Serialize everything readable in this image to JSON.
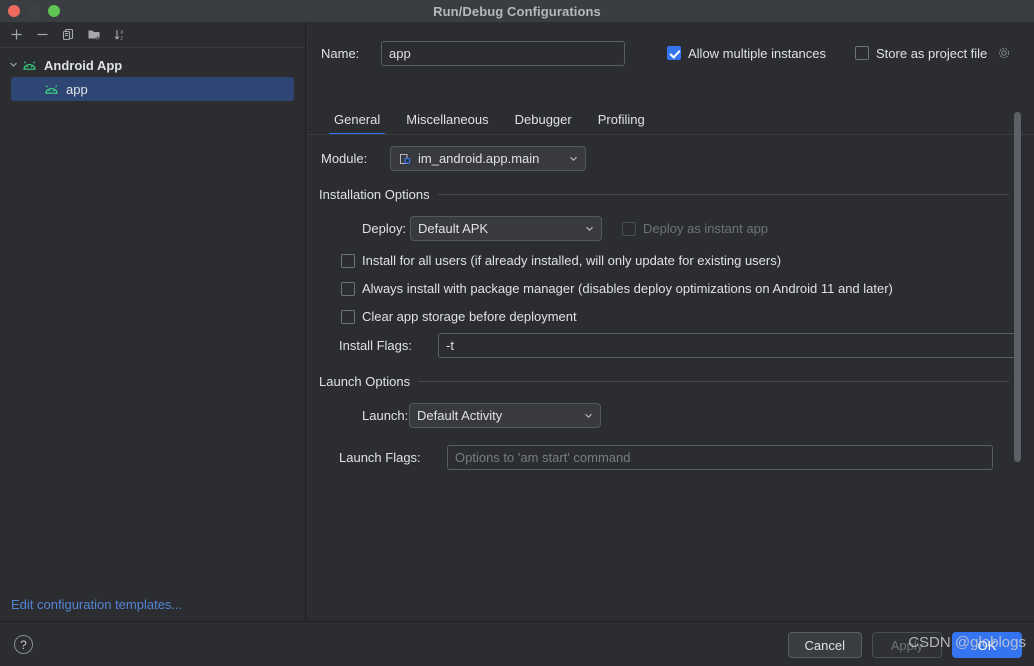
{
  "window": {
    "title": "Run/Debug Configurations",
    "traffic_lights": [
      "close-red",
      "minimize-grey",
      "maximize-green"
    ]
  },
  "sidebar": {
    "toolbar": [
      {
        "name": "add-configuration-button",
        "icon": "plus-icon"
      },
      {
        "name": "remove-configuration-button",
        "icon": "minus-icon"
      },
      {
        "name": "copy-configuration-button",
        "icon": "copy-icon"
      },
      {
        "name": "new-folder-button",
        "icon": "folder-add-icon"
      },
      {
        "name": "sort-configurations-button",
        "icon": "sort-az-icon"
      }
    ],
    "tree": [
      {
        "label": "Android App",
        "icon": "android-icon",
        "expanded": true,
        "selected": false,
        "level": 0
      },
      {
        "label": "app",
        "icon": "android-icon",
        "expanded": false,
        "selected": true,
        "level": 1
      }
    ],
    "edit_templates_link": "Edit configuration templates..."
  },
  "form": {
    "name_label": "Name:",
    "name_value": "app",
    "allow_multiple_instances": {
      "label": "Allow multiple instances",
      "checked": true
    },
    "store_as_project_file": {
      "label": "Store as project file",
      "checked": false,
      "icon": "gear-icon"
    },
    "tabs": [
      {
        "label": "General",
        "active": true
      },
      {
        "label": "Miscellaneous",
        "active": false
      },
      {
        "label": "Debugger",
        "active": false
      },
      {
        "label": "Profiling",
        "active": false
      }
    ],
    "module_label": "Module:",
    "module_value": "im_android.app.main",
    "module_icon": "module-icon",
    "installation_options": {
      "title": "Installation Options",
      "deploy_label": "Deploy:",
      "deploy_value": "Default APK",
      "deploy_instant_app": {
        "label": "Deploy as instant app",
        "checked": false,
        "disabled": true
      },
      "checkboxes": [
        {
          "label": "Install for all users (if already installed, will only update for existing users)",
          "checked": false
        },
        {
          "label": "Always install with package manager (disables deploy optimizations on Android 11 and later)",
          "checked": false
        },
        {
          "label": "Clear app storage before deployment",
          "checked": false
        }
      ],
      "install_flags_label": "Install Flags:",
      "install_flags_value": "-t"
    },
    "launch_options": {
      "title": "Launch Options",
      "launch_label": "Launch:",
      "launch_value": "Default Activity",
      "launch_flags_label": "Launch Flags:",
      "launch_flags_value": "",
      "launch_flags_placeholder": "Options to 'am start' command"
    }
  },
  "footer": {
    "help_label": "?",
    "cancel_label": "Cancel",
    "apply_label": "Apply",
    "apply_disabled": true,
    "ok_label": "OK"
  },
  "watermark": "CSDN @globlogs",
  "colors": {
    "accent": "#3574f0",
    "selection": "#2f4675",
    "link": "#5585d6",
    "android_green": "#3ddc84",
    "background": "#2b2d30",
    "titlebar": "#3a3d41"
  }
}
